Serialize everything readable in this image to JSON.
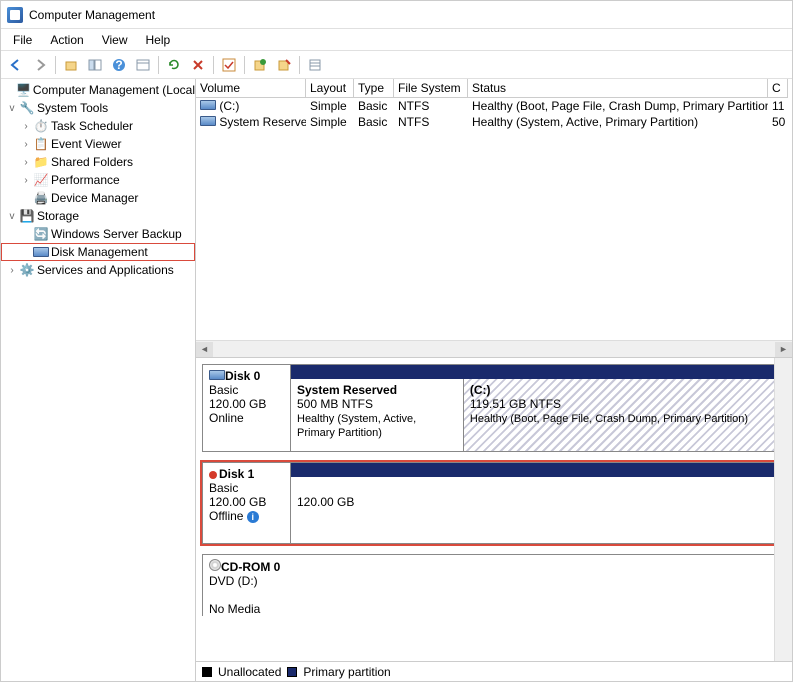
{
  "window": {
    "title": "Computer Management"
  },
  "menu": {
    "file": "File",
    "action": "Action",
    "view": "View",
    "help": "Help"
  },
  "tree": {
    "root": "Computer Management (Local",
    "systools": "System Tools",
    "task": "Task Scheduler",
    "event": "Event Viewer",
    "shared": "Shared Folders",
    "perf": "Performance",
    "devmgr": "Device Manager",
    "storage": "Storage",
    "wsb": "Windows Server Backup",
    "diskmgmt": "Disk Management",
    "services": "Services and Applications"
  },
  "vol": {
    "headers": {
      "volume": "Volume",
      "layout": "Layout",
      "type": "Type",
      "fs": "File System",
      "status": "Status",
      "cap": "C"
    },
    "rows": [
      {
        "name": "(C:)",
        "layout": "Simple",
        "type": "Basic",
        "fs": "NTFS",
        "status": "Healthy (Boot, Page File, Crash Dump, Primary Partition)",
        "cap": "11"
      },
      {
        "name": "System Reserved",
        "layout": "Simple",
        "type": "Basic",
        "fs": "NTFS",
        "status": "Healthy (System, Active, Primary Partition)",
        "cap": "50"
      }
    ]
  },
  "disks": {
    "d0": {
      "title": "Disk 0",
      "type": "Basic",
      "size": "120.00 GB",
      "state": "Online",
      "p1": {
        "name": "System Reserved",
        "size": "500 MB NTFS",
        "status": "Healthy (System, Active, Primary Partition)"
      },
      "p2": {
        "name": "(C:)",
        "size": "119.51 GB NTFS",
        "status": "Healthy (Boot, Page File, Crash Dump, Primary Partition)"
      }
    },
    "d1": {
      "title": "Disk 1",
      "type": "Basic",
      "size": "120.00 GB",
      "state": "Offline",
      "p1": {
        "size": "120.00 GB"
      }
    },
    "cd": {
      "title": "CD-ROM 0",
      "type": "DVD (D:)",
      "state": "No Media"
    }
  },
  "legend": {
    "unalloc": "Unallocated",
    "primary": "Primary partition"
  }
}
